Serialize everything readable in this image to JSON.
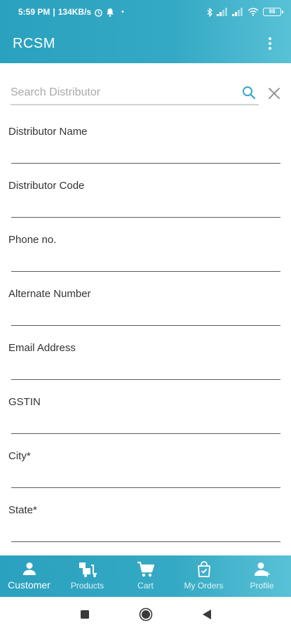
{
  "status_bar": {
    "time": "5:59 PM",
    "network_speed": "134KB/s",
    "battery": "98"
  },
  "app_bar": {
    "title": "RCSM"
  },
  "search": {
    "placeholder": "Search Distributor"
  },
  "form_fields": [
    {
      "label": "Distributor Name"
    },
    {
      "label": "Distributor Code"
    },
    {
      "label": "Phone no."
    },
    {
      "label": "Alternate Number"
    },
    {
      "label": "Email Address"
    },
    {
      "label": "GSTIN"
    },
    {
      "label": "City*"
    },
    {
      "label": "State*"
    }
  ],
  "bottom_nav": {
    "items": [
      {
        "label": "Customer",
        "icon": "person-icon",
        "active": true
      },
      {
        "label": "Products",
        "icon": "products-icon",
        "active": false
      },
      {
        "label": "Cart",
        "icon": "cart-icon",
        "active": false
      },
      {
        "label": "My Orders",
        "icon": "orders-bag-icon",
        "active": false
      },
      {
        "label": "Profile",
        "icon": "person-add-icon",
        "active": false
      }
    ]
  },
  "colors": {
    "primary": "#35a9c4",
    "search_icon": "#35a9c4"
  }
}
